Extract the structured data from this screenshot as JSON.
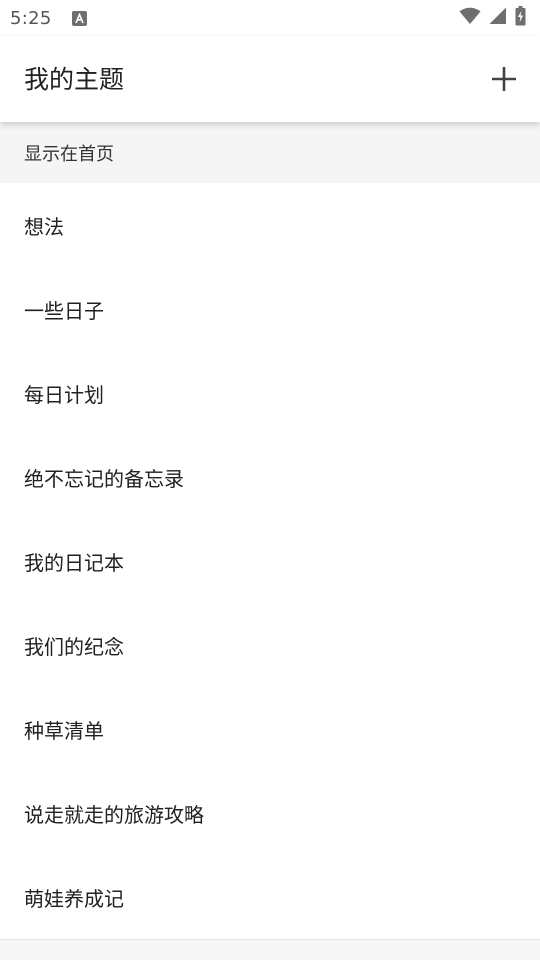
{
  "status_bar": {
    "time": "5:25",
    "icons": [
      "notification-a-icon",
      "wifi-icon",
      "cellular-signal-icon",
      "battery-charging-icon"
    ]
  },
  "app_bar": {
    "title": "我的主题",
    "action_icon": "add-icon"
  },
  "section": {
    "header": "显示在首页"
  },
  "topics": [
    {
      "label": "想法"
    },
    {
      "label": "一些日子"
    },
    {
      "label": "每日计划"
    },
    {
      "label": "绝不忘记的备忘录"
    },
    {
      "label": "我的日记本"
    },
    {
      "label": "我们的纪念"
    },
    {
      "label": "种草清单"
    },
    {
      "label": "说走就走的旅游攻略"
    },
    {
      "label": "萌娃养成记"
    }
  ],
  "colors": {
    "text_primary": "#212121",
    "section_background": "#f5f5f5",
    "status_icons": "#6f6f6f"
  }
}
